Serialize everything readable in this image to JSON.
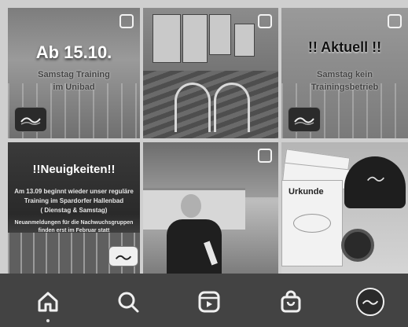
{
  "posts": [
    {
      "headline": "Ab 15.10.",
      "sub1": "Samstag Training",
      "sub2": "im Unibad"
    },
    {
      "caption": ""
    },
    {
      "headline": "!! Aktuell !!",
      "sub1": "Samstag kein",
      "sub2": "Trainingsbetrieb"
    },
    {
      "title": "!!Neuigkeiten!!",
      "line1": "Am 13.09 beginnt wieder unser reguläre",
      "line2": "Training im Spardorfer Hallenbad",
      "line3": "( Dienstag & Samstag)",
      "line4": "Neuanmeldungen für die Nachwuchsgruppen",
      "line5": "finden erst im Februar statt"
    },
    {
      "caption": ""
    },
    {
      "cert_title": "Urkunde"
    }
  ],
  "nav": {
    "items": [
      "home-icon",
      "search-icon",
      "reels-icon",
      "shop-icon",
      "profile-avatar"
    ],
    "active": "home"
  }
}
